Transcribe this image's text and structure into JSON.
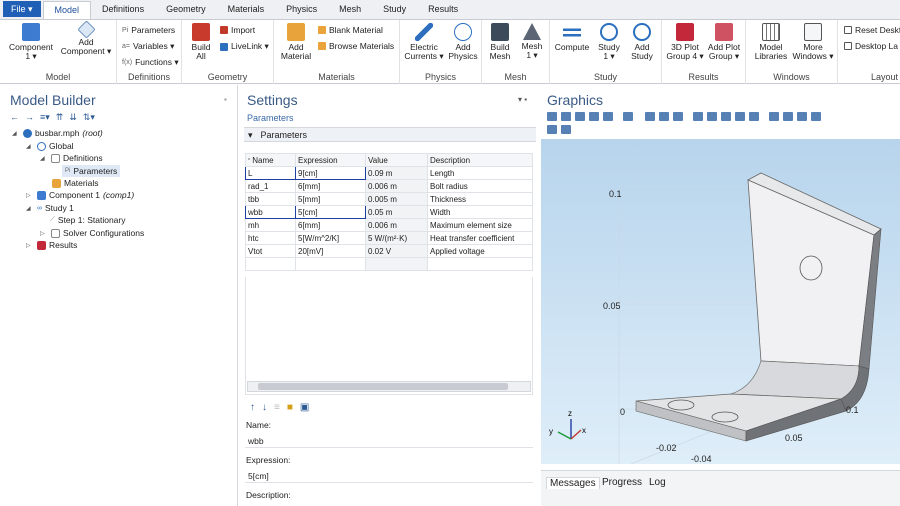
{
  "menu": {
    "file": "File ▾",
    "tabs": [
      "Model",
      "Definitions",
      "Geometry",
      "Materials",
      "Physics",
      "Mesh",
      "Study",
      "Results"
    ]
  },
  "ribbon": {
    "model": {
      "component": "Component\n1 ▾",
      "add_component": "Add\nComponent ▾",
      "group": "Model"
    },
    "definitions": {
      "parameters": "Parameters",
      "variables": "Variables ▾",
      "functions": "Functions ▾",
      "group": "Definitions"
    },
    "geometry": {
      "build_all": "Build\nAll",
      "import": "Import",
      "livelink": "LiveLink ▾",
      "group": "Geometry"
    },
    "materials": {
      "add_material": "Add\nMaterial",
      "blank_material": "Blank Material",
      "browse_materials": "Browse Materials",
      "group": "Materials"
    },
    "physics": {
      "electric_currents": "Electric\nCurrents ▾",
      "add_physics": "Add\nPhysics",
      "group": "Physics"
    },
    "mesh": {
      "build_mesh": "Build\nMesh",
      "mesh1": "Mesh\n1 ▾",
      "group": "Mesh"
    },
    "study": {
      "compute": "Compute",
      "study1": "Study\n1 ▾",
      "add_study": "Add\nStudy",
      "group": "Study"
    },
    "results": {
      "plot_group": "3D Plot\nGroup 4 ▾",
      "add_plot_group": "Add Plot\nGroup ▾",
      "group": "Results"
    },
    "windows": {
      "model_libraries": "Model\nLibraries",
      "more_windows": "More\nWindows ▾",
      "group": "Windows"
    },
    "layout": {
      "reset_desktop": "Reset Deskt",
      "desktop_layout": "Desktop La",
      "group": "Layout"
    }
  },
  "model_builder": {
    "title": "Model Builder",
    "tree": [
      {
        "label": "busbar.mph",
        "suffix": "(root)"
      },
      {
        "label": "Global"
      },
      {
        "label": "Definitions"
      },
      {
        "label": "Parameters"
      },
      {
        "label": "Materials"
      },
      {
        "label": "Component 1",
        "suffix": "(comp1)"
      },
      {
        "label": "Study 1"
      },
      {
        "label": "Step 1: Stationary"
      },
      {
        "label": "Solver Configurations"
      },
      {
        "label": "Results"
      }
    ]
  },
  "settings": {
    "title": "Settings",
    "subtitle": "Parameters",
    "section": "Parameters",
    "columns": [
      "Name",
      "Expression",
      "Value",
      "Description"
    ],
    "rows": [
      {
        "name": "L",
        "expr": "9[cm]",
        "value": "0.09 m",
        "desc": "Length"
      },
      {
        "name": "rad_1",
        "expr": "6[mm]",
        "value": "0.006 m",
        "desc": "Bolt radius"
      },
      {
        "name": "tbb",
        "expr": "5[mm]",
        "value": "0.005 m",
        "desc": "Thickness"
      },
      {
        "name": "wbb",
        "expr": "5[cm]",
        "value": "0.05 m",
        "desc": "Width"
      },
      {
        "name": "mh",
        "expr": "6[mm]",
        "value": "0.006 m",
        "desc": "Maximum element size"
      },
      {
        "name": "htc",
        "expr": "5[W/m^2/K]",
        "value": "5 W/(m²·K)",
        "desc": "Heat transfer coefficient"
      },
      {
        "name": "Vtot",
        "expr": "20[mV]",
        "value": "0.02 V",
        "desc": "Applied voltage"
      }
    ],
    "name_label": "Name:",
    "name_value": "wbb",
    "expr_label": "Expression:",
    "expr_value": "5[cm]",
    "desc_label": "Description:"
  },
  "graphics": {
    "title": "Graphics",
    "axis_labels": {
      "z1": "0.1",
      "z2": "0.05",
      "z0": "0",
      "x1": "0.1",
      "x2": "0.05",
      "y1": "-0.02",
      "y2": "-0.04"
    },
    "triad": {
      "z": "z",
      "y": "y",
      "x": "x"
    }
  },
  "bottom_tabs": [
    "Messages",
    "Progress",
    "Log"
  ]
}
